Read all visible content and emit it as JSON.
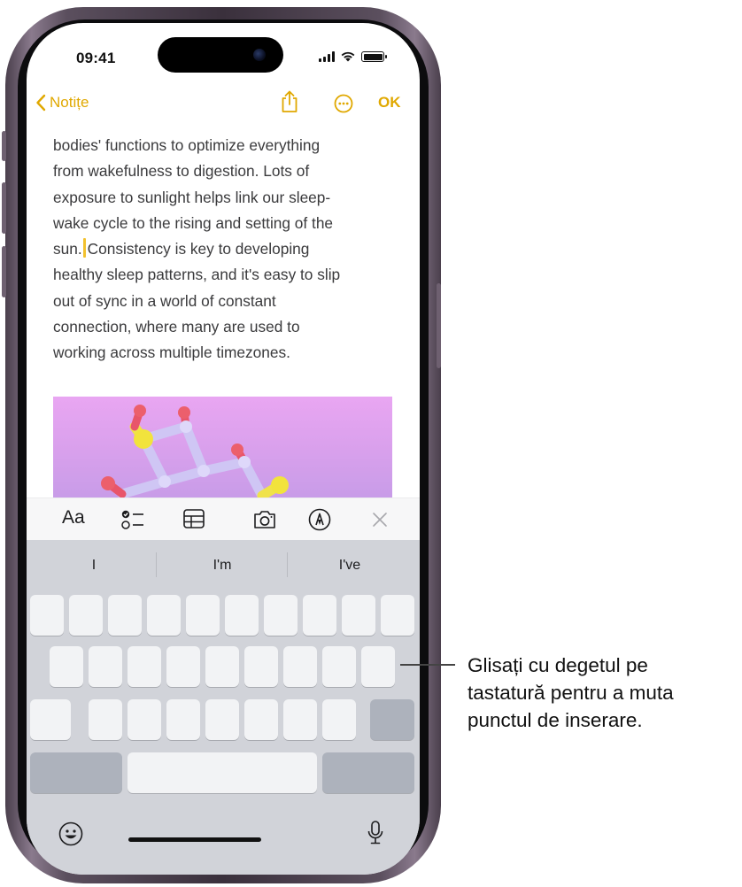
{
  "status_bar": {
    "time": "09:41"
  },
  "nav": {
    "back_label": "Notițe",
    "done_label": "OK"
  },
  "note": {
    "lines": [
      "bodies' functions to optimize everything",
      "from wakefulness to digestion. Lots of",
      "exposure to sunlight helps link our sleep-",
      "wake cycle to the rising and setting of the"
    ],
    "cursor_line_before": "sun.",
    "cursor_line_after": "Consistency is key to developing",
    "lines_after": [
      "healthy sleep patterns, and it's easy to slip",
      "out of sync in a world of constant",
      "connection, where many are used to",
      "working across multiple timezones."
    ]
  },
  "toolbar": {
    "text_format_label": "Aa",
    "icons": [
      "checklist-icon",
      "table-icon",
      "camera-icon",
      "markup-icon",
      "close-icon"
    ]
  },
  "keyboard": {
    "suggestions": [
      "I",
      "I'm",
      "I've"
    ],
    "icons": [
      "emoji-icon",
      "microphone-icon"
    ]
  },
  "callout": {
    "lines": [
      "Glisați cu degetul pe",
      "tastatură pentru a muta",
      "punctul de inserare."
    ]
  },
  "colors": {
    "accent": "#e0a800",
    "cursor": "#f2c12e",
    "keyboard_bg": "#d1d3d9"
  }
}
